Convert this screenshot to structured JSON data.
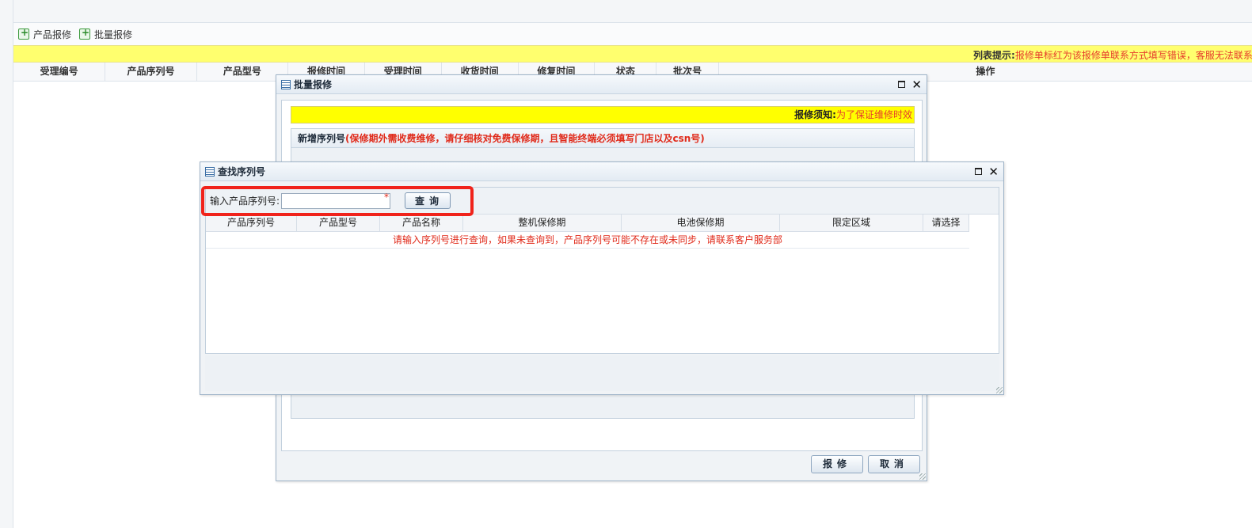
{
  "toolbar": {
    "product_repair": "产品报修",
    "batch_repair": "批量报修"
  },
  "hint": {
    "label": "列表提示:",
    "text": "报修单标红为该报修单联系方式填写错误，客服无法联系"
  },
  "main_table": {
    "columns": [
      "受理编号",
      "产品序列号",
      "产品型号",
      "报修时间",
      "受理时间",
      "收货时间",
      "修复时间",
      "状态",
      "批次号",
      "操作"
    ]
  },
  "batch_dialog": {
    "title": "批量报修",
    "notice_label": "报修须知:",
    "notice_text": "为了保证维修时效",
    "serial_section_title": "新增序列号",
    "serial_section_warning": "(保修期外需收费维修，请仔细核对免费保修期，且智能终端必须填写门店以及csn号)",
    "repair_button": "报修",
    "cancel_button": "取消"
  },
  "lookup_dialog": {
    "title": "查找序列号",
    "search_label": "输入产品序列号:",
    "search_value": "",
    "required_mark": "*",
    "query_button": "查询",
    "columns": [
      "产品序列号",
      "产品型号",
      "产品名称",
      "整机保修期",
      "电池保修期",
      "限定区域",
      "请选择"
    ],
    "empty_message": "请输入序列号进行查询，如果未查询到，产品序列号可能不存在或未同步，请联系客户服务部"
  }
}
